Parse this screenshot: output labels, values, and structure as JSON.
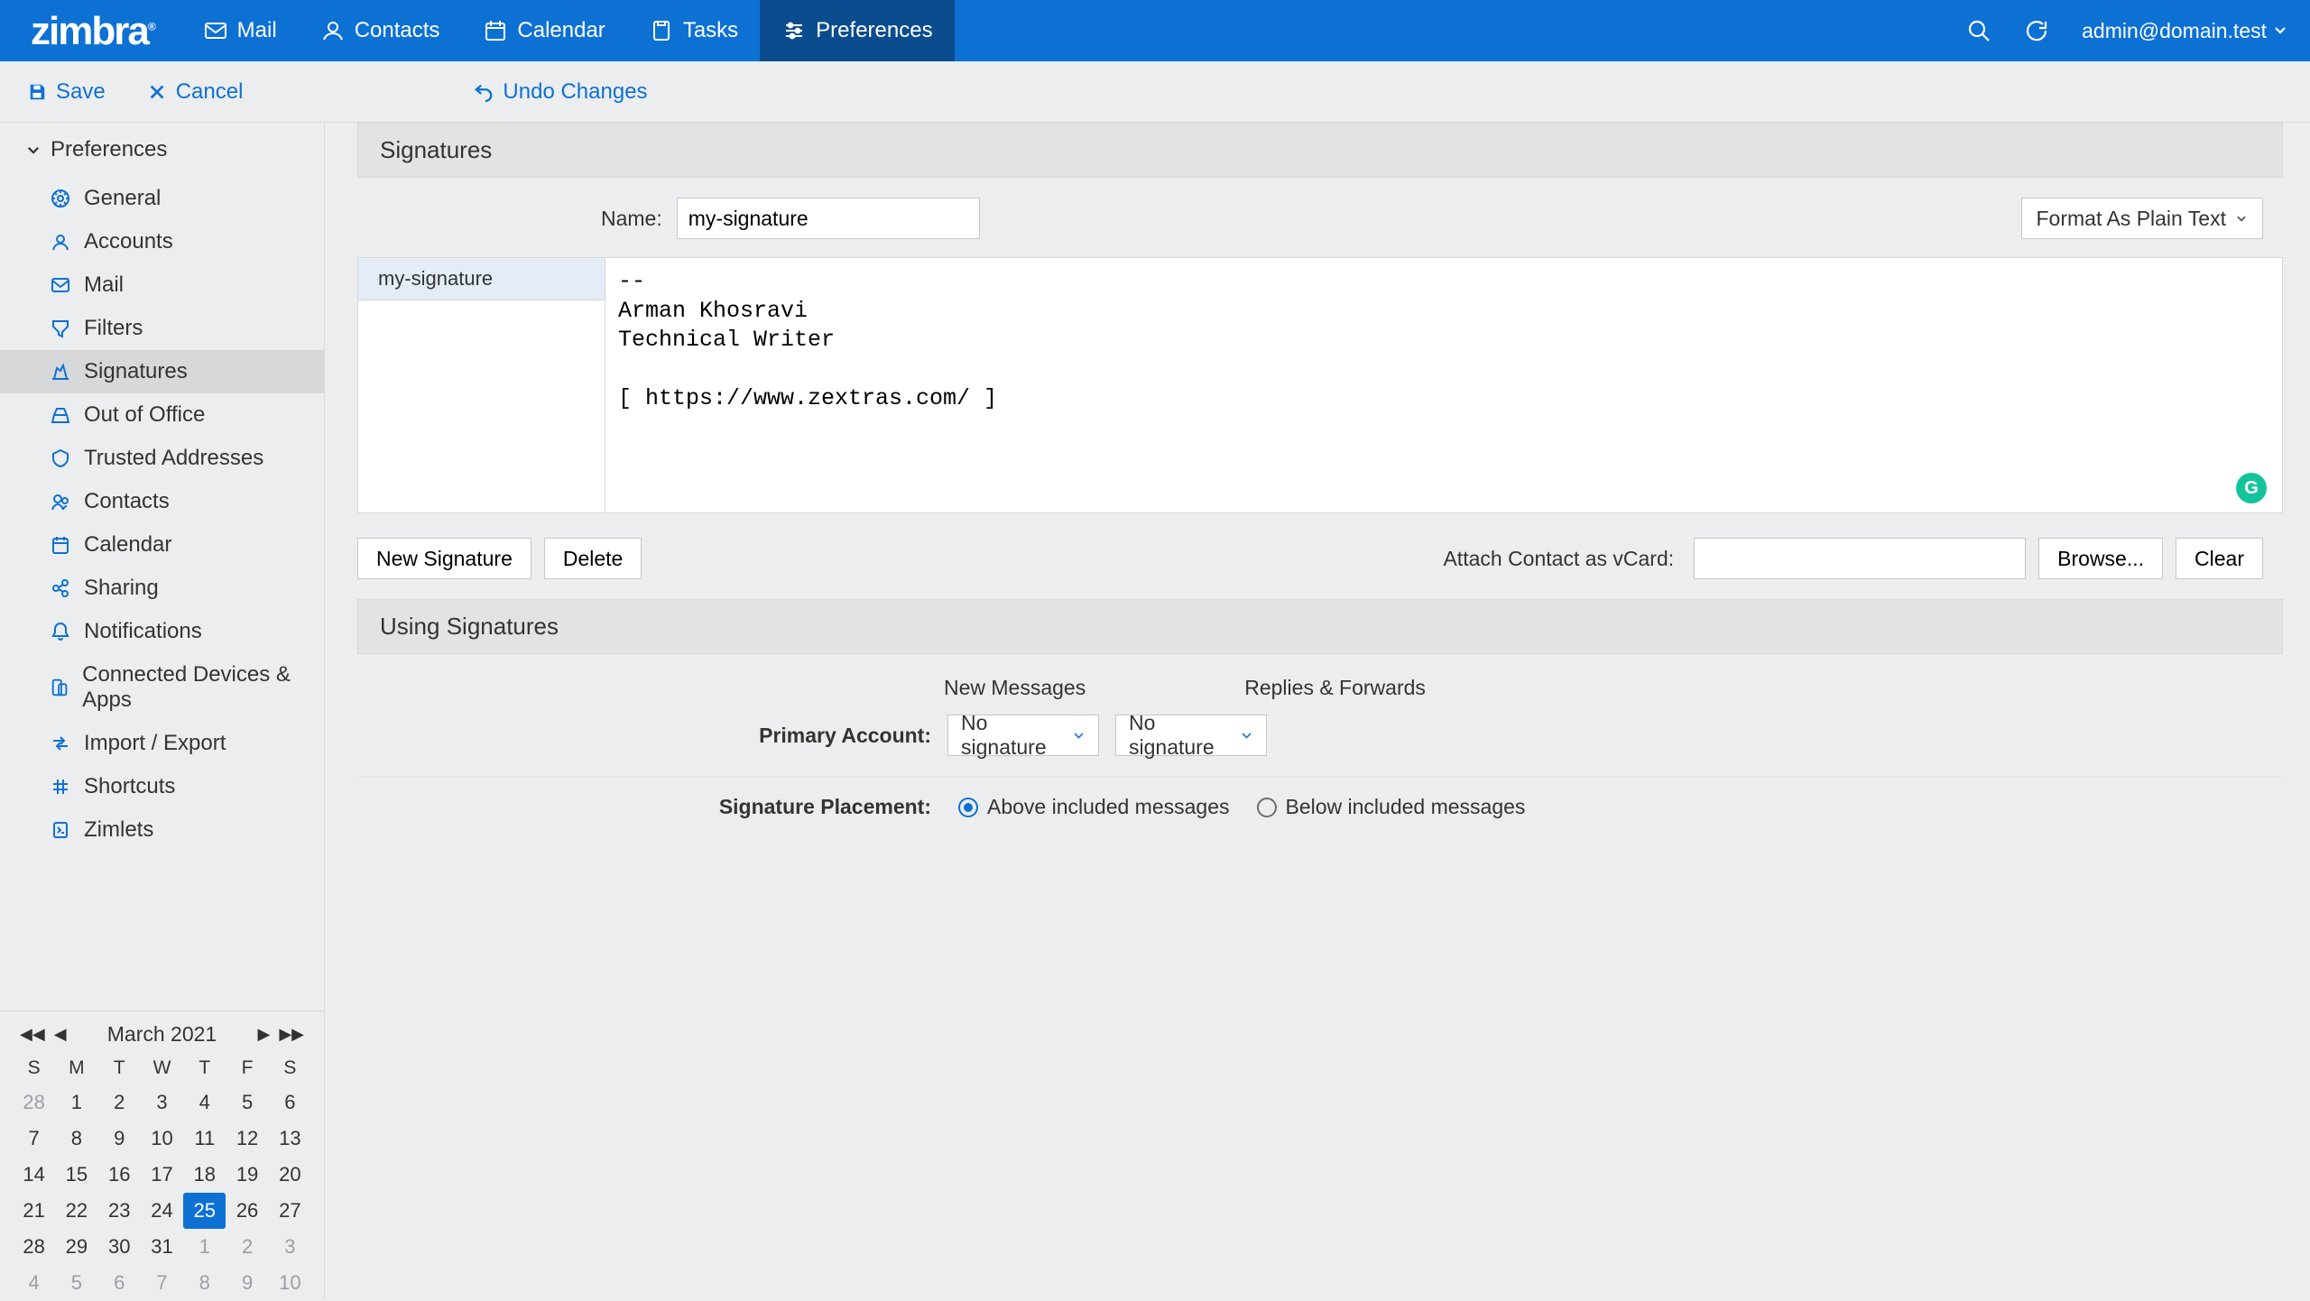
{
  "brand": "zimbra",
  "nav": {
    "mail": "Mail",
    "contacts": "Contacts",
    "calendar": "Calendar",
    "tasks": "Tasks",
    "preferences": "Preferences"
  },
  "user": "admin@domain.test",
  "actions": {
    "save": "Save",
    "cancel": "Cancel",
    "undo": "Undo Changes"
  },
  "sidebar": {
    "header": "Preferences",
    "items": [
      "General",
      "Accounts",
      "Mail",
      "Filters",
      "Signatures",
      "Out of Office",
      "Trusted Addresses",
      "Contacts",
      "Calendar",
      "Sharing",
      "Notifications",
      "Connected Devices & Apps",
      "Import / Export",
      "Shortcuts",
      "Zimlets"
    ]
  },
  "calendar": {
    "title": "March 2021",
    "dow": [
      "S",
      "M",
      "T",
      "W",
      "T",
      "F",
      "S"
    ],
    "grid": [
      [
        28,
        1,
        2,
        3,
        4,
        5,
        6
      ],
      [
        7,
        8,
        9,
        10,
        11,
        12,
        13
      ],
      [
        14,
        15,
        16,
        17,
        18,
        19,
        20
      ],
      [
        21,
        22,
        23,
        24,
        25,
        26,
        27
      ],
      [
        28,
        29,
        30,
        31,
        1,
        2,
        3
      ],
      [
        4,
        5,
        6,
        7,
        8,
        9,
        10
      ]
    ],
    "today": 25
  },
  "sig": {
    "section": "Signatures",
    "name_label": "Name:",
    "name_value": "my-signature",
    "format_btn": "Format As Plain Text",
    "list_item": "my-signature",
    "body": "--\nArman Khosravi\nTechnical Writer\n\n[ https://www.zextras.com/ ]",
    "new_btn": "New Signature",
    "delete_btn": "Delete",
    "vcard_label": "Attach Contact as vCard:",
    "browse_btn": "Browse...",
    "clear_btn": "Clear"
  },
  "using": {
    "section": "Using Signatures",
    "col1": "New Messages",
    "col2": "Replies & Forwards",
    "primary_label": "Primary Account:",
    "nosig": "No signature",
    "placement_label": "Signature Placement:",
    "above": "Above included messages",
    "below": "Below included messages"
  }
}
